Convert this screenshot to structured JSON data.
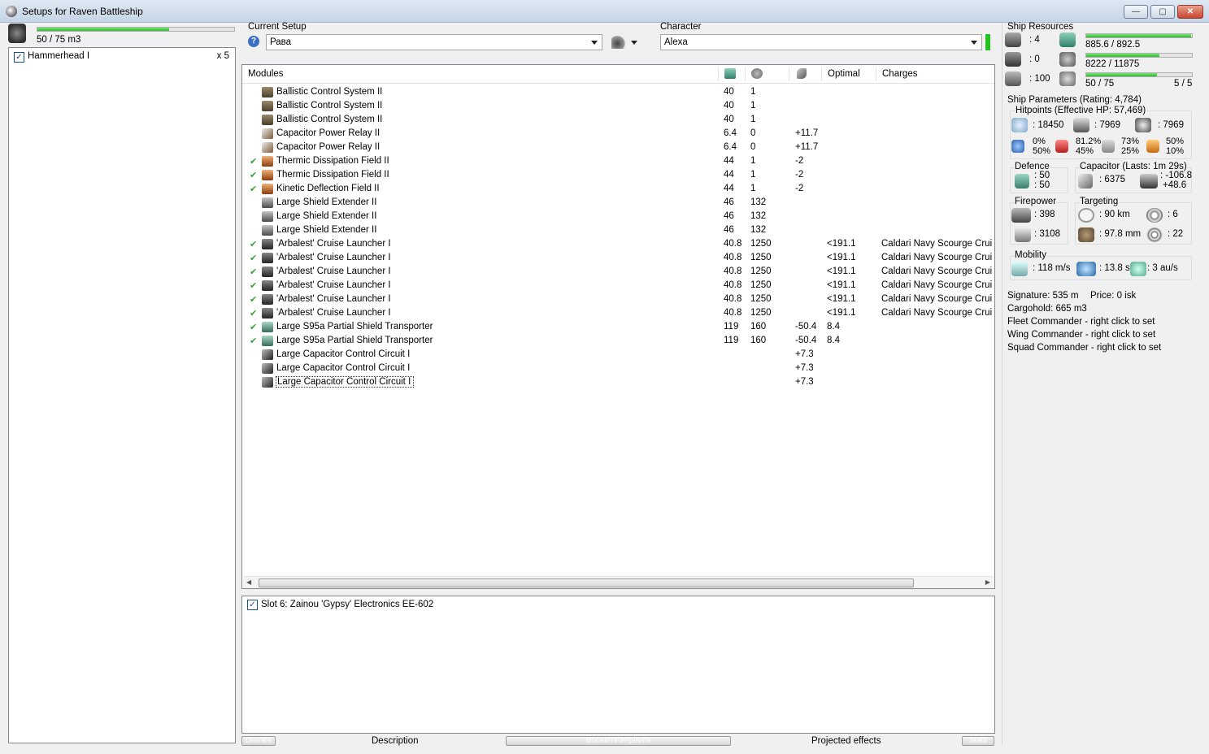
{
  "window": {
    "title": "Setups for Raven Battleship",
    "minimize_glyph": "—",
    "maximize_glyph": "▢",
    "close_glyph": "✕"
  },
  "drones_panel": {
    "bay_usage": "50 / 75 m3",
    "bay_fill_percent": 67,
    "items": [
      {
        "name": "Hammerhead I",
        "count": "x 5",
        "checked": true
      }
    ]
  },
  "setup": {
    "label": "Current Setup",
    "selected": "Рава",
    "help_glyph": "?"
  },
  "character": {
    "label": "Character",
    "selected": "Alexa"
  },
  "modules": {
    "headers": {
      "name": "Modules",
      "optimal": "Optimal",
      "charges": "Charges"
    },
    "rows": [
      {
        "checked": false,
        "name": "Ballistic Control System II",
        "cpu": "40",
        "pg": "1",
        "cap": "",
        "optimal": "",
        "charge": "",
        "icon": "ballistic-control-icon"
      },
      {
        "checked": false,
        "name": "Ballistic Control System II",
        "cpu": "40",
        "pg": "1",
        "cap": "",
        "optimal": "",
        "charge": "",
        "icon": "ballistic-control-icon"
      },
      {
        "checked": false,
        "name": "Ballistic Control System II",
        "cpu": "40",
        "pg": "1",
        "cap": "",
        "optimal": "",
        "charge": "",
        "icon": "ballistic-control-icon"
      },
      {
        "checked": false,
        "name": "Capacitor Power Relay II",
        "cpu": "6.4",
        "pg": "0",
        "cap": "+11.7",
        "optimal": "",
        "charge": "",
        "icon": "capacitor-relay-icon"
      },
      {
        "checked": false,
        "name": "Capacitor Power Relay II",
        "cpu": "6.4",
        "pg": "0",
        "cap": "+11.7",
        "optimal": "",
        "charge": "",
        "icon": "capacitor-relay-icon"
      },
      {
        "checked": true,
        "name": "Thermic Dissipation Field II",
        "cpu": "44",
        "pg": "1",
        "cap": "-2",
        "optimal": "",
        "charge": "",
        "icon": "hardener-icon"
      },
      {
        "checked": true,
        "name": "Thermic Dissipation Field II",
        "cpu": "44",
        "pg": "1",
        "cap": "-2",
        "optimal": "",
        "charge": "",
        "icon": "hardener-icon"
      },
      {
        "checked": true,
        "name": "Kinetic Deflection Field II",
        "cpu": "44",
        "pg": "1",
        "cap": "-2",
        "optimal": "",
        "charge": "",
        "icon": "hardener-icon"
      },
      {
        "checked": false,
        "name": "Large Shield Extender II",
        "cpu": "46",
        "pg": "132",
        "cap": "",
        "optimal": "",
        "charge": "",
        "icon": "shield-extender-icon"
      },
      {
        "checked": false,
        "name": "Large Shield Extender II",
        "cpu": "46",
        "pg": "132",
        "cap": "",
        "optimal": "",
        "charge": "",
        "icon": "shield-extender-icon"
      },
      {
        "checked": false,
        "name": "Large Shield Extender II",
        "cpu": "46",
        "pg": "132",
        "cap": "",
        "optimal": "",
        "charge": "",
        "icon": "shield-extender-icon"
      },
      {
        "checked": true,
        "name": "'Arbalest' Cruise Launcher I",
        "cpu": "40.8",
        "pg": "1250",
        "cap": "",
        "optimal": "<191.1",
        "charge": "Caldari Navy Scourge Cruise",
        "icon": "launcher-icon"
      },
      {
        "checked": true,
        "name": "'Arbalest' Cruise Launcher I",
        "cpu": "40.8",
        "pg": "1250",
        "cap": "",
        "optimal": "<191.1",
        "charge": "Caldari Navy Scourge Cruise",
        "icon": "launcher-icon"
      },
      {
        "checked": true,
        "name": "'Arbalest' Cruise Launcher I",
        "cpu": "40.8",
        "pg": "1250",
        "cap": "",
        "optimal": "<191.1",
        "charge": "Caldari Navy Scourge Cruise",
        "icon": "launcher-icon"
      },
      {
        "checked": true,
        "name": "'Arbalest' Cruise Launcher I",
        "cpu": "40.8",
        "pg": "1250",
        "cap": "",
        "optimal": "<191.1",
        "charge": "Caldari Navy Scourge Cruise",
        "icon": "launcher-icon"
      },
      {
        "checked": true,
        "name": "'Arbalest' Cruise Launcher I",
        "cpu": "40.8",
        "pg": "1250",
        "cap": "",
        "optimal": "<191.1",
        "charge": "Caldari Navy Scourge Cruise",
        "icon": "launcher-icon"
      },
      {
        "checked": true,
        "name": "'Arbalest' Cruise Launcher I",
        "cpu": "40.8",
        "pg": "1250",
        "cap": "",
        "optimal": "<191.1",
        "charge": "Caldari Navy Scourge Cruise",
        "icon": "launcher-icon"
      },
      {
        "checked": true,
        "name": "Large S95a Partial Shield Transporter",
        "cpu": "119",
        "pg": "160",
        "cap": "-50.4",
        "optimal": "8.4",
        "charge": "",
        "icon": "shield-transporter-icon"
      },
      {
        "checked": true,
        "name": "Large S95a Partial Shield Transporter",
        "cpu": "119",
        "pg": "160",
        "cap": "-50.4",
        "optimal": "8.4",
        "charge": "",
        "icon": "shield-transporter-icon"
      },
      {
        "checked": false,
        "name": "Large Capacitor Control Circuit I",
        "cpu": "",
        "pg": "",
        "cap": "+7.3",
        "optimal": "",
        "charge": "",
        "icon": "rig-icon"
      },
      {
        "checked": false,
        "name": "Large Capacitor Control Circuit I",
        "cpu": "",
        "pg": "",
        "cap": "+7.3",
        "optimal": "",
        "charge": "",
        "icon": "rig-icon"
      },
      {
        "checked": false,
        "name": "Large Capacitor Control Circuit I",
        "cpu": "",
        "pg": "",
        "cap": "+7.3",
        "optimal": "",
        "charge": "",
        "icon": "rig-icon"
      }
    ]
  },
  "implants": {
    "items": [
      {
        "name": "Slot 6: Zainou 'Gypsy' Electronics EE-602",
        "checked": true
      }
    ]
  },
  "bottom_tabs": {
    "drones": "Drones",
    "description": "Description",
    "boosters": "Boosters\\Implants",
    "projected": "Projected effects",
    "stats": "Stats"
  },
  "resources": {
    "title": "Ship Resources",
    "turret_slots": ": 4",
    "launcher_slots": ": 0",
    "calibration": ": 100",
    "cpu": "885.6 / 892.5",
    "cpu_fill": 0.99,
    "powergrid": "8222 / 11875",
    "powergrid_fill": 0.69,
    "drone_bandwidth": "50 / 75",
    "drone_bw_fill": 0.67,
    "drones_active": "5 / 5"
  },
  "params": {
    "title": "Ship Parameters (Rating: 4,784)",
    "hitpoints_title": "Hitpoints (Effective HP: 57,469)",
    "shield_hp": ": 18450",
    "armor_hp": ": 7969",
    "structure_hp": ": 7969",
    "resists": {
      "em": [
        "0%",
        "50%"
      ],
      "thermal": [
        "81.2%",
        "45%"
      ],
      "kinetic": [
        "73%",
        "25%"
      ],
      "explosive": [
        "50%",
        "10%"
      ]
    },
    "defence_title": "Defence",
    "defence_a": ": 50",
    "defence_b": ": 50",
    "capacitor_title": "Capacitor (Lasts: 1m 29s)",
    "capacitor": ": 6375",
    "cap_delta_a": ": -106.8",
    "cap_delta_b": "+48.6",
    "firepower_title": "Firepower",
    "dps": ": 398",
    "volley": ": 3108",
    "targeting_title": "Targeting",
    "target_range": ": 90 km",
    "max_targets": ": 6",
    "scan_res": ": 97.8 mm",
    "sensor_strength": ": 22",
    "mobility_title": "Mobility",
    "velocity": ": 118 m/s",
    "align_time": ": 13.8 s",
    "warp_speed": ": 3 au/s",
    "signature": "Signature: 535 m",
    "price": "Price: 0 isk",
    "cargohold": "Cargohold: 665 m3",
    "fleet_cmd": "Fleet Commander - right click to set",
    "wing_cmd": "Wing Commander - right click to set",
    "squad_cmd": "Squad Commander - right click to set"
  },
  "colors": {
    "bar_green": "#2dbb2d",
    "check_green": "#3aa23a",
    "titlebar": "#c5d4e6"
  }
}
